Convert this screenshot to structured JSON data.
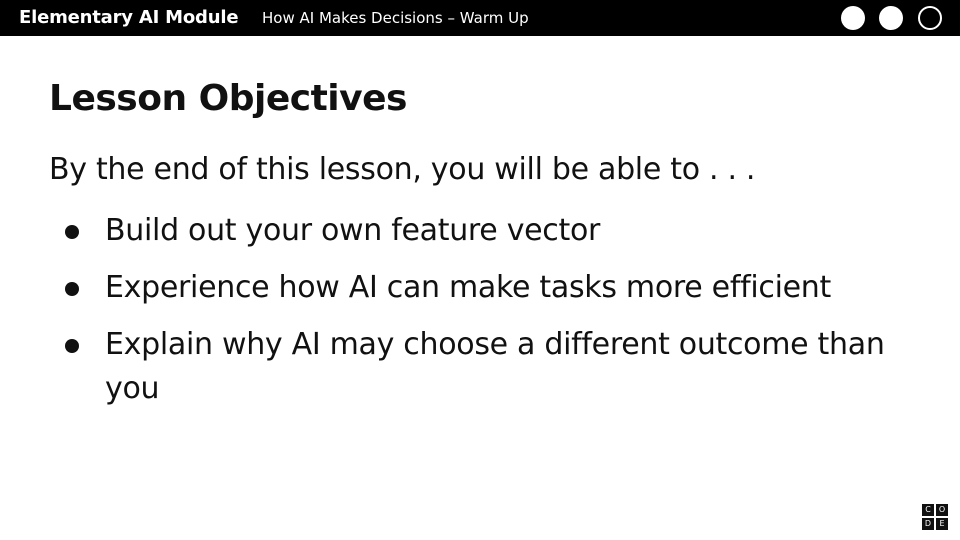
{
  "header": {
    "module_name": "Elementary AI Module",
    "lesson_title": "How AI Makes Decisions – Warm Up",
    "progress_dots": [
      {
        "state": "filled"
      },
      {
        "state": "filled"
      },
      {
        "state": "current"
      }
    ]
  },
  "slide": {
    "title": "Lesson Objectives",
    "intro": "By the end of this lesson, you will be able to . . .",
    "objectives": [
      "Build out your own feature vector",
      "Experience how AI can make tasks more efficient",
      "Explain why AI may choose a different outcome than you"
    ]
  },
  "logo": {
    "letters": [
      "C",
      "O",
      "D",
      "E"
    ]
  },
  "colors": {
    "header_bg": "#000000",
    "text": "#111111",
    "background": "#ffffff"
  }
}
